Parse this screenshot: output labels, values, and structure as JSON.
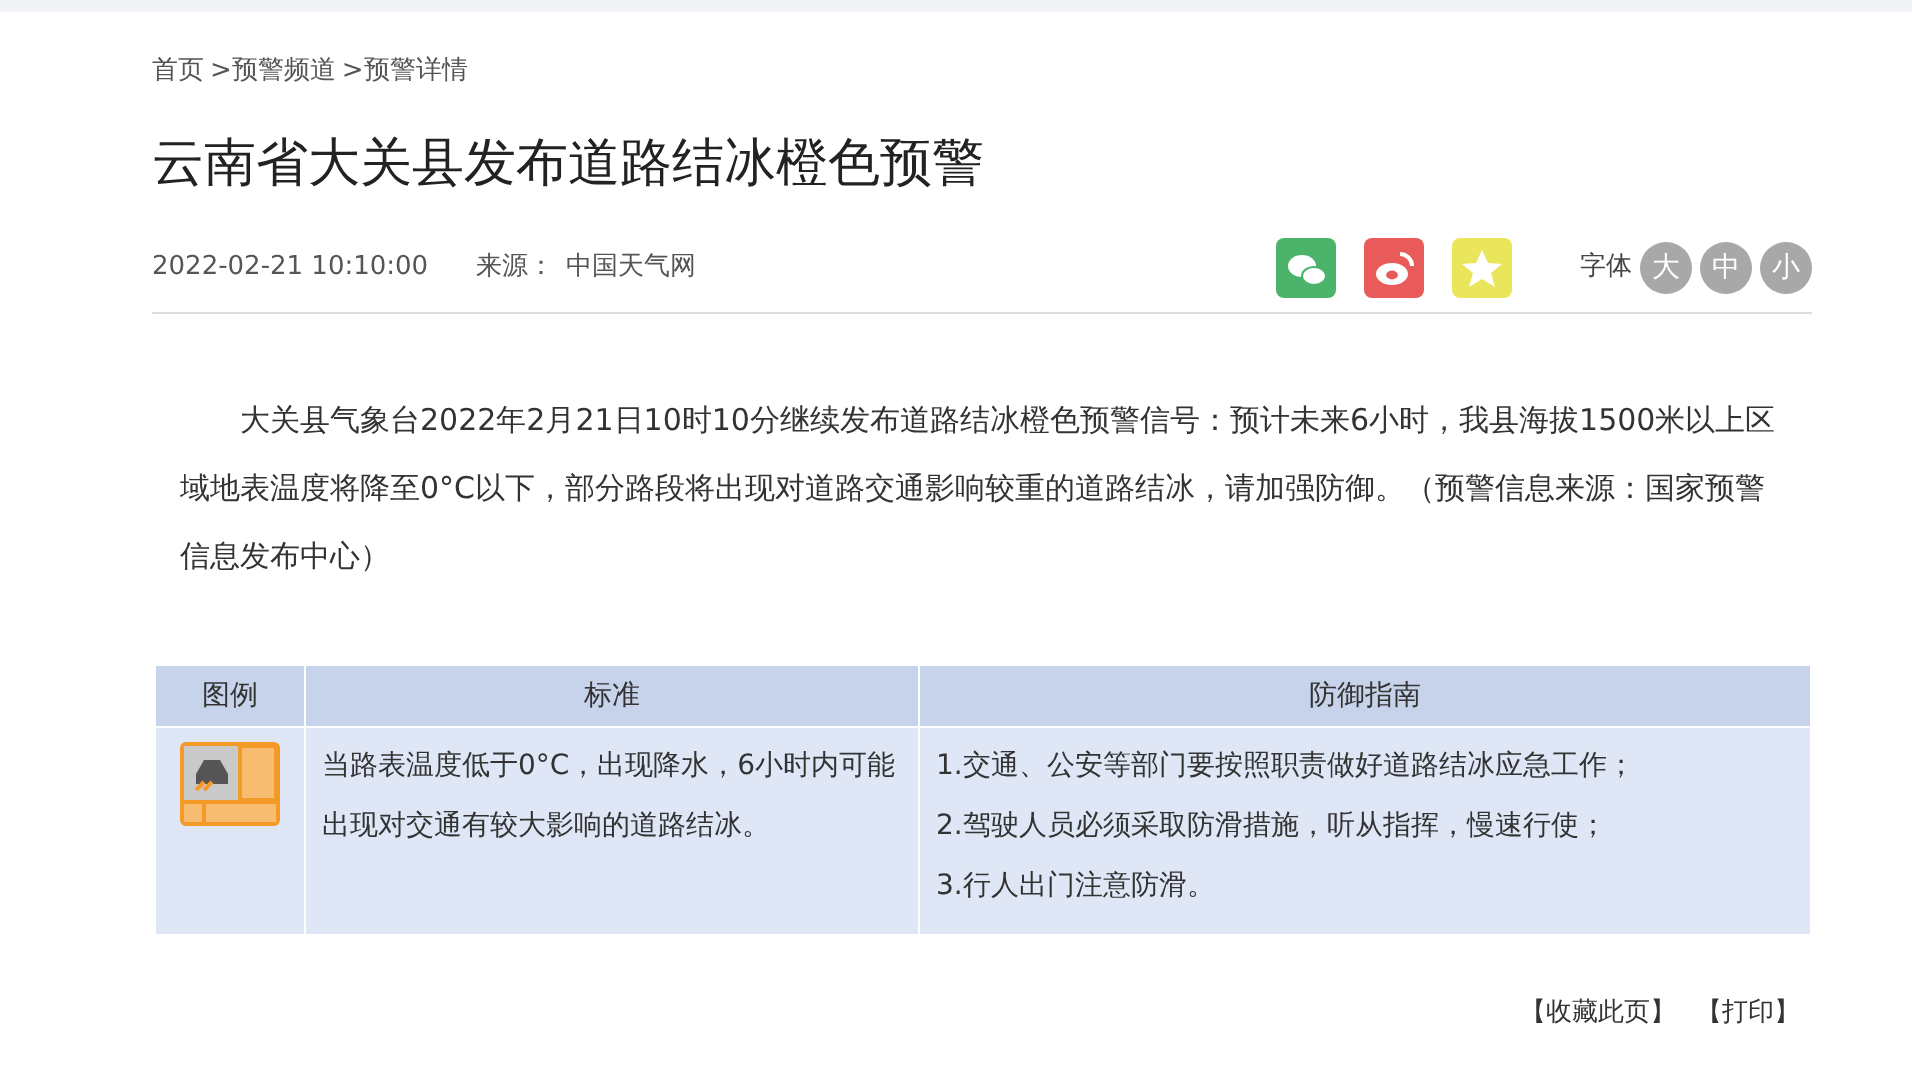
{
  "breadcrumb": [
    "首页",
    ">预警频道",
    ">预警详情"
  ],
  "title": "云南省大关县发布道路结冰橙色预警",
  "meta": {
    "time": "2022-02-21 10:10:00",
    "source_label": "来源：",
    "source": "中国天气网"
  },
  "share": [
    {
      "kind": "wechat",
      "color": "#4cb46a"
    },
    {
      "kind": "weibo",
      "color": "#e95a5a"
    },
    {
      "kind": "qzone",
      "color": "#eae65c"
    }
  ],
  "font_size": {
    "label": "字体",
    "options": [
      "大",
      "中",
      "小"
    ]
  },
  "body": "大关县气象台2022年2月21日10时10分继续发布道路结冰橙色预警信号：预计未来6小时，我县海拔1500米以上区域地表温度将降至0°C以下，部分路段将出现对道路交通影响较重的道路结冰，请加强防御。（预警信息来源：国家预警信息发布中心）",
  "table": {
    "columns": [
      "图例",
      "标准",
      "防御指南"
    ],
    "row": {
      "standard": "当路表温度低于0°C，出现降水，6小时内可能出现对交通有较大影响的道路结冰。",
      "guide": [
        "1.交通、公安等部门要按照职责做好道路结冰应急工作；",
        "2.驾驶人员必须采取防滑措施，听从指挥，慢速行使；",
        "3.行人出门注意防滑。"
      ]
    }
  },
  "footer_links": [
    "【收藏此页】",
    "【打印】"
  ]
}
